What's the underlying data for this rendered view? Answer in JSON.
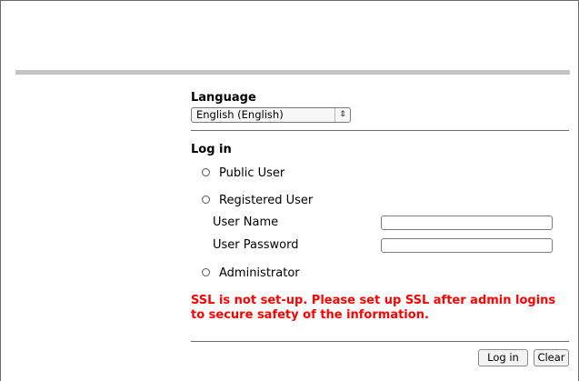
{
  "language": {
    "heading": "Language",
    "selected": "English (English)",
    "icon": "updown-chevron-icon"
  },
  "login": {
    "heading": "Log in",
    "options": [
      {
        "label": "Public User"
      },
      {
        "label": "Registered User"
      },
      {
        "label": "Administrator"
      }
    ],
    "user_name_label": "User Name",
    "user_password_label": "User Password",
    "user_name_value": "",
    "user_password_value": ""
  },
  "warning": {
    "text": "SSL is not set-up. Please set up SSL after admin logins to secure safety of the information.",
    "color": "#ff0000"
  },
  "buttons": {
    "login": "Log in",
    "clear": "Clear"
  }
}
